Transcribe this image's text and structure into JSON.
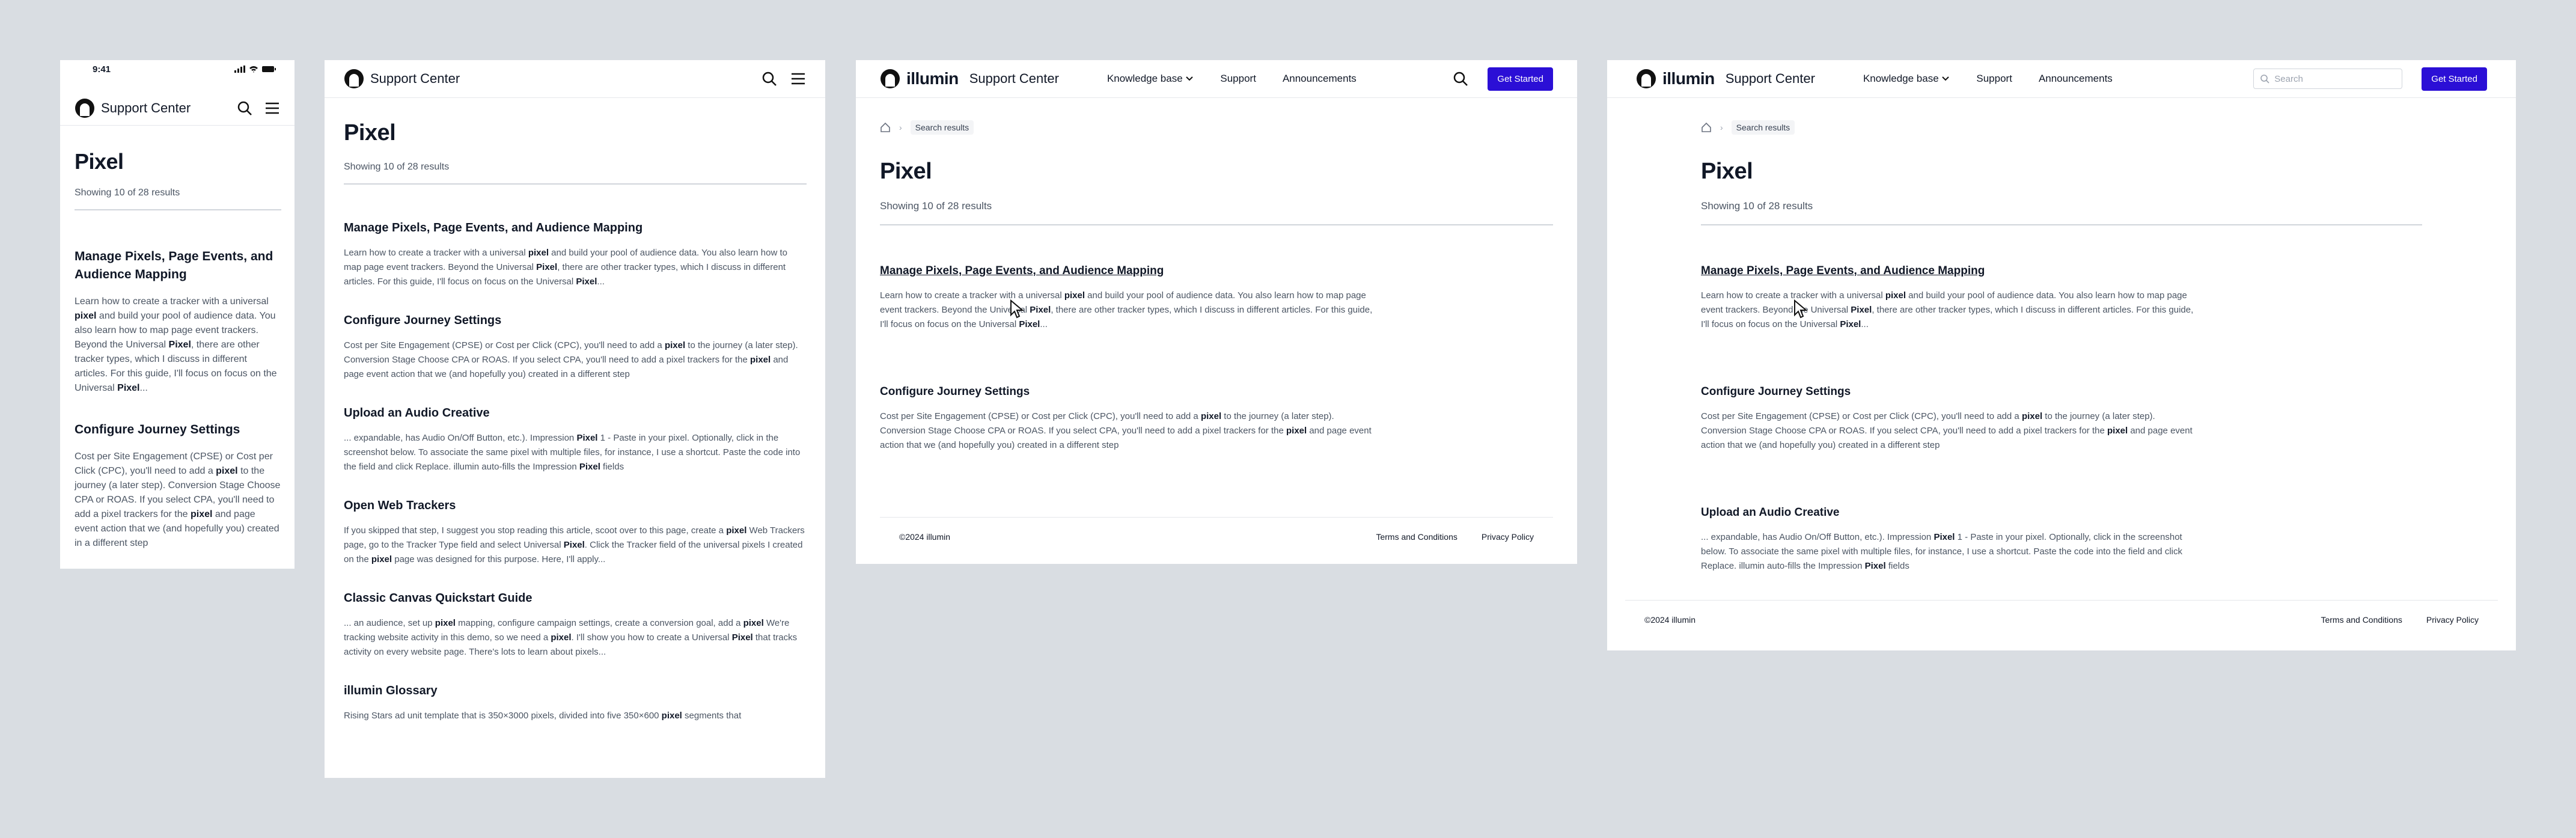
{
  "brand": {
    "name": "illumin",
    "section": "Support Center"
  },
  "nav": {
    "knowledge_base": "Knowledge base",
    "support": "Support",
    "announcements": "Announcements",
    "cta": "Get Started"
  },
  "search": {
    "placeholder": "Search"
  },
  "status": {
    "time": "9:41"
  },
  "breadcrumb": {
    "current": "Search results"
  },
  "page": {
    "title": "Pixel",
    "summary": "Showing 10 of 28 results"
  },
  "results": [
    {
      "title": "Manage Pixels, Page Events, and Audience Mapping",
      "snippet_html": "Learn how to create a tracker with a universal <b>pixel</b> and build your pool of audience data. You also learn how to map page event trackers. Beyond the Universal <b>Pixel</b>, there are other tracker types, which I discuss in different articles. For this guide, I'll focus on focus on the Universal <b>Pixel</b>..."
    },
    {
      "title": "Configure Journey Settings",
      "snippet_html": "Cost per Site Engagement (CPSE) or Cost per Click (CPC), you'll need to add a <b>pixel</b> to the journey (a later step). Conversion Stage Choose CPA or ROAS. If you select CPA, you'll need to add a pixel trackers for the <b>pixel</b> and page event action that we (and hopefully you) created in a different step"
    },
    {
      "title": "Upload an Audio Creative",
      "snippet_html": "... expandable, has Audio On/Off Button, etc.). Impression <b>Pixel</b> 1 - Paste in your pixel. Optionally, click in the screenshot below. To associate the same pixel with multiple files, for instance, I use a shortcut. Paste the code into the field and click Replace. illumin auto-fills the Impression <b>Pixel</b> fields"
    },
    {
      "title": "Open Web Trackers",
      "snippet_html": "If you skipped that step, I suggest you stop reading this article, scoot over to this page, create a <b>pixel</b> Web Trackers page, go to the Tracker Type field and select Universal <b>Pixel</b>. Click the Tracker field of the universal pixels I created on the <b>pixel</b> page was designed for this purpose. Here, I'll apply..."
    },
    {
      "title": "Classic Canvas Quickstart Guide",
      "snippet_html": "... an audience, set up <b>pixel</b> mapping, configure campaign settings, create a conversion goal, add a <b>pixel</b> We're tracking website activity in this demo, so we need a <b>pixel</b>. I'll show you how to create a Universal <b>Pixel</b> that tracks activity on every website page. There's lots to learn about pixels..."
    },
    {
      "title": "illumin Glossary",
      "snippet_html": "Rising Stars ad unit template that is 350×3000 pixels, divided into five 350×600 <b>pixel</b> segments that"
    }
  ],
  "footer": {
    "copyright": "©2024 illumin",
    "terms": "Terms and Conditions",
    "privacy": "Privacy Policy"
  },
  "colors": {
    "accent": "#2b0fd6",
    "background": "#d9dde2"
  }
}
